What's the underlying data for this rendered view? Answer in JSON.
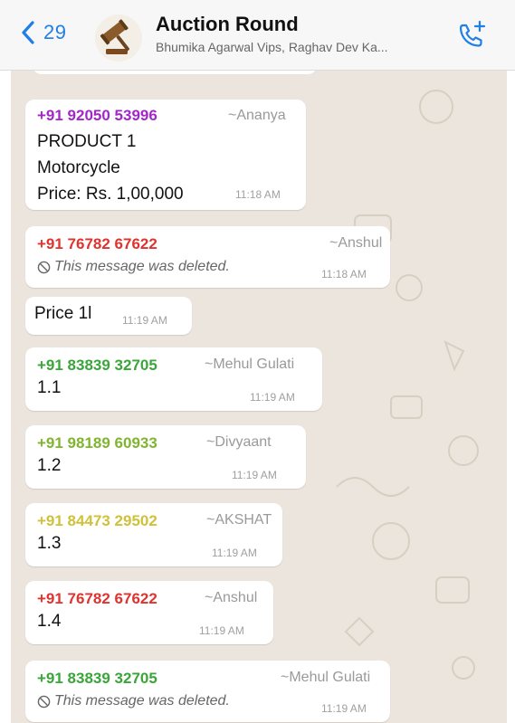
{
  "header": {
    "back_count": "29",
    "title": "Auction Round",
    "subtitle": "Bhumika Agarwal Vips, Raghav Dev Ka...",
    "back_icon": "chevron-left-icon",
    "call_icon": "add-call-icon",
    "accent_color": "#1f7fe6"
  },
  "messages": [
    {
      "sender": "+91 92050 53996",
      "alias": "~Ananya",
      "lines": [
        "PRODUCT 1",
        "Motorcycle",
        "Price: Rs. 1,00,000"
      ],
      "time": "11:18 AM",
      "sender_color": "#a226c9"
    },
    {
      "sender": "+91 76782 67622",
      "alias": "~Anshul",
      "deleted": "This message was deleted.",
      "time": "11:18 AM",
      "sender_color": "#e0332f"
    },
    {
      "lines": [
        "Price 1l"
      ],
      "time": "11:19 AM"
    },
    {
      "sender": "+91 83839 32705",
      "alias": "~Mehul Gulati",
      "lines": [
        "1.1"
      ],
      "time": "11:19 AM",
      "sender_color": "#3aa63a"
    },
    {
      "sender": "+91 98189 60933",
      "alias": "~Divyaant",
      "lines": [
        "1.2"
      ],
      "time": "11:19 AM",
      "sender_color": "#7fb52f"
    },
    {
      "sender": "+91 84473 29502",
      "alias": "~AKSHAT",
      "lines": [
        "1.3"
      ],
      "time": "11:19 AM",
      "sender_color": "#cfc23a"
    },
    {
      "sender": "+91 76782 67622",
      "alias": "~Anshul",
      "lines": [
        "1.4"
      ],
      "time": "11:19 AM",
      "sender_color": "#e0332f"
    },
    {
      "sender": "+91 83839 32705",
      "alias": "~Mehul Gulati",
      "deleted": "This message was deleted.",
      "time": "11:19 AM",
      "sender_color": "#3aa63a"
    }
  ]
}
